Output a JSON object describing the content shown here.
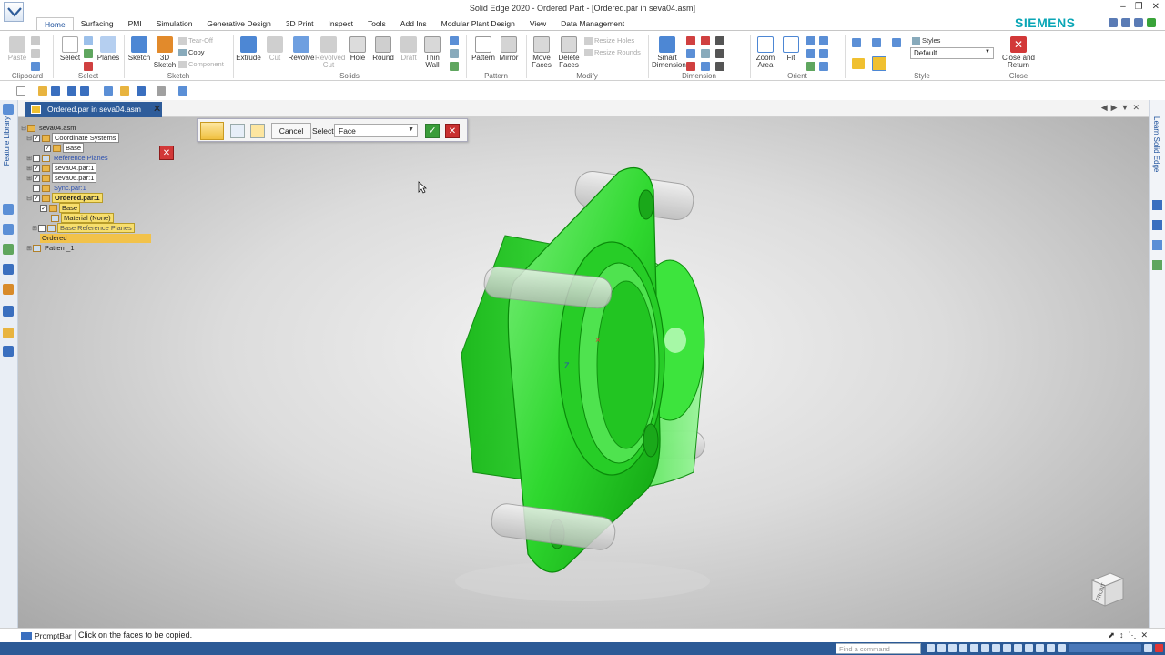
{
  "app": {
    "window_title": "Solid Edge 2020 - Ordered Part - [Ordered.par in seva04.asm]",
    "brand": "SIEMENS"
  },
  "ribbon": {
    "tabs": [
      {
        "label": "Home",
        "active": true
      },
      {
        "label": "Surfacing"
      },
      {
        "label": "PMI"
      },
      {
        "label": "Simulation"
      },
      {
        "label": "Generative Design"
      },
      {
        "label": "3D Print"
      },
      {
        "label": "Inspect"
      },
      {
        "label": "Tools"
      },
      {
        "label": "Add Ins"
      },
      {
        "label": "Modular Plant Design"
      },
      {
        "label": "View"
      },
      {
        "label": "Data Management"
      }
    ],
    "groups": {
      "clipboard": "Clipboard",
      "select": "Select",
      "sketch": "Sketch",
      "solids": "Solids",
      "pattern": "Pattern",
      "modify": "Modify",
      "dimension": "Dimension",
      "orient": "Orient",
      "style": "Style",
      "close": "Close"
    },
    "tools": {
      "paste": "Paste",
      "select": "Select",
      "planes": "Planes",
      "sketch": "Sketch",
      "sketch3d": "3D Sketch",
      "tear_off": "Tear-Off",
      "copy": "Copy",
      "component": "Component",
      "extrude": "Extrude",
      "cut": "Cut",
      "revolve": "Revolve",
      "revolved_cut": "Revolved Cut",
      "hole": "Hole",
      "round": "Round",
      "draft": "Draft",
      "thin_wall": "Thin Wall",
      "pattern": "Pattern",
      "mirror": "Mirror",
      "move_faces": "Move Faces",
      "delete_faces": "Delete Faces",
      "resize_holes": "Resize Holes",
      "resize_rounds": "Resize Rounds",
      "smart_dimension": "Smart Dimension",
      "zoom_area": "Zoom Area",
      "fit": "Fit",
      "styles": "Styles",
      "style_value": "Default",
      "close_return": "Close and Return"
    }
  },
  "document": {
    "tab_label": "Ordered.par in seva04.asm"
  },
  "left_rail": {
    "feature_library": "Feature Library"
  },
  "right_rail": {
    "learn": "Learn Solid Edge"
  },
  "command_bar": {
    "cancel": "Cancel",
    "select_label": "Select:",
    "select_value": "Face"
  },
  "pathfinder": {
    "items": [
      {
        "label": "seva04.asm"
      },
      {
        "label": "Coordinate Systems"
      },
      {
        "label": "Base"
      },
      {
        "label": "Reference Planes"
      },
      {
        "label": "seva04.par:1"
      },
      {
        "label": "seva06.par:1"
      },
      {
        "label": "Sync.par:1"
      },
      {
        "label": "Ordered.par:1"
      },
      {
        "label": "Base"
      },
      {
        "label": "Material (None)"
      },
      {
        "label": "Base Reference Planes"
      },
      {
        "label": "Ordered"
      },
      {
        "label": "Pattern_1"
      }
    ]
  },
  "viewport": {
    "axis_label": "Z",
    "viewcube_face": "FRONT"
  },
  "promptbar": {
    "label": "PromptBar",
    "text": "Click on the faces to be copied."
  },
  "statusbar": {
    "find_placeholder": "Find a command"
  },
  "colors": {
    "selection_green": "#1fd31f",
    "accent_blue": "#2c5a96",
    "brand_teal": "#0aa6b6"
  }
}
